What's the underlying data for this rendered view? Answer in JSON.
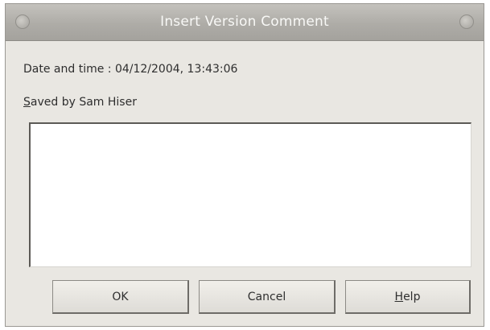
{
  "window": {
    "title": "Insert Version Comment"
  },
  "info": {
    "datetime_label": "Date and time : 04/12/2004, 13:43:06",
    "saved_by_mnemonic": "S",
    "saved_by_rest": "aved by Sam Hiser"
  },
  "comment": {
    "value": ""
  },
  "buttons": {
    "ok_label": "OK",
    "cancel_label": "Cancel",
    "help_mnemonic": "H",
    "help_rest": "elp"
  },
  "colors": {
    "titlebar": "#aeaca7",
    "dialog_bg": "#e9e7e2",
    "title_text": "#f8f8f6"
  }
}
